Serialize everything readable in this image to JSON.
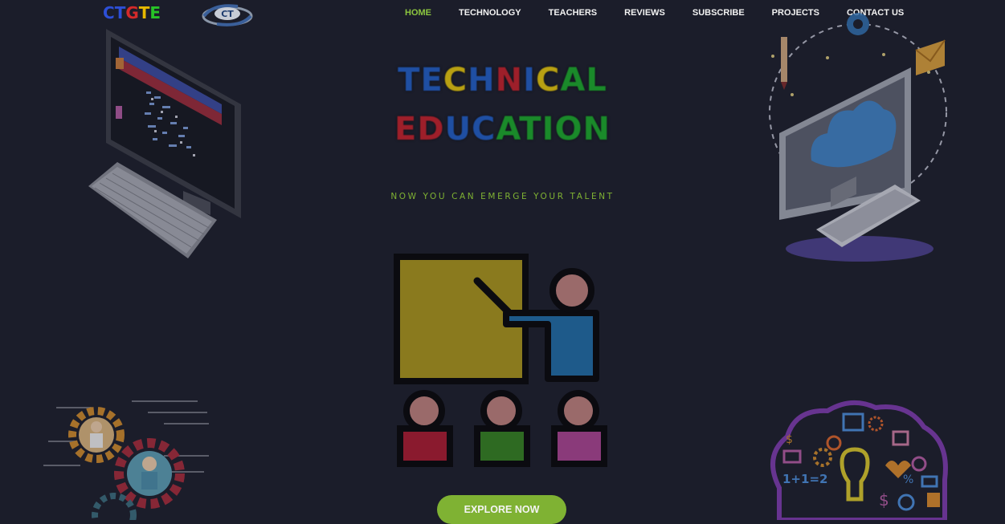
{
  "brand": {
    "logo_letters": [
      {
        "char": "C",
        "color": "#2d4fd6"
      },
      {
        "char": "T",
        "color": "#2d4fd6"
      },
      {
        "char": "G",
        "color": "#d42a2a"
      },
      {
        "char": "T",
        "color": "#e6b800"
      },
      {
        "char": "E",
        "color": "#27c227"
      }
    ],
    "badge_text": "CT"
  },
  "nav": {
    "items": [
      {
        "label": "HOME",
        "active": true
      },
      {
        "label": "TECHNOLOGY",
        "active": false
      },
      {
        "label": "TEACHERS",
        "active": false
      },
      {
        "label": "REVIEWS",
        "active": false
      },
      {
        "label": "SUBSCRIBE",
        "active": false
      },
      {
        "label": "PROJECTS",
        "active": false
      },
      {
        "label": "CONTACT US",
        "active": false
      }
    ]
  },
  "hero": {
    "title_line1": [
      {
        "char": "T",
        "color": "#1f4fa3"
      },
      {
        "char": "E",
        "color": "#1f4fa3"
      },
      {
        "char": "C",
        "color": "#b8a012"
      },
      {
        "char": "H",
        "color": "#1f4fa3"
      },
      {
        "char": "N",
        "color": "#9e1f2a"
      },
      {
        "char": "I",
        "color": "#1f4fa3"
      },
      {
        "char": "C",
        "color": "#b8a012"
      },
      {
        "char": "A",
        "color": "#1a8a2a"
      },
      {
        "char": "L",
        "color": "#1a8a2a"
      }
    ],
    "title_line2": [
      {
        "char": "E",
        "color": "#9e1f2a"
      },
      {
        "char": "D",
        "color": "#9e1f2a"
      },
      {
        "char": "U",
        "color": "#1f4fa3"
      },
      {
        "char": "C",
        "color": "#1f4fa3"
      },
      {
        "char": "A",
        "color": "#1a8a2a"
      },
      {
        "char": "T",
        "color": "#1a8a2a"
      },
      {
        "char": "I",
        "color": "#1a8a2a"
      },
      {
        "char": "O",
        "color": "#1a8a2a"
      },
      {
        "char": "N",
        "color": "#1a8a2a"
      }
    ],
    "tagline": "NOW YOU CAN EMERGE YOUR TALENT",
    "cta_label": "EXPLORE NOW"
  },
  "colors": {
    "background": "#1b1d2a",
    "accent_green": "#7fb233",
    "nav_text": "#f2f2f2"
  },
  "illustrations": {
    "top_left": "desktop-computer-icon",
    "top_right": "cloud-computer-icon",
    "center": "classroom-teacher-icon",
    "bottom_left": "gears-people-icon",
    "bottom_right": "brain-ideas-icon"
  }
}
